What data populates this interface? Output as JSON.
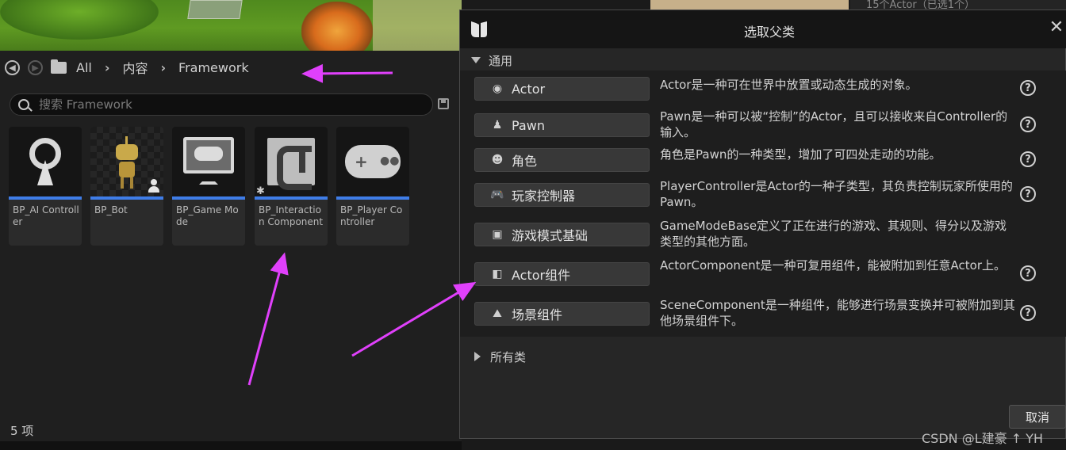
{
  "viewport": {
    "outliner_title": "15个Actor（已选1个）"
  },
  "content_browser": {
    "breadcrumb": [
      "All",
      "内容",
      "Framework"
    ],
    "search_placeholder": "搜索 Framework",
    "assets": [
      {
        "label": "BP_AI Controller"
      },
      {
        "label": "BP_Bot"
      },
      {
        "label": "BP_Game Mode"
      },
      {
        "label": "BP_Interaction Component"
      },
      {
        "label": "BP_Player Controller"
      }
    ],
    "item_count": "5 项"
  },
  "dialog": {
    "title": "选取父类",
    "section_common": "通用",
    "section_all": "所有类",
    "classes": [
      {
        "name": "Actor",
        "icon": "actor-icon",
        "description": "Actor是一种可在世界中放置或动态生成的对象。",
        "help": true
      },
      {
        "name": "Pawn",
        "icon": "pawn-icon",
        "description": "Pawn是一种可以被“控制”的Actor，且可以接收来自Controller的输入。",
        "help": true
      },
      {
        "name": "角色",
        "icon": "character-icon",
        "description": "角色是Pawn的一种类型，增加了可四处走动的功能。",
        "help": true
      },
      {
        "name": "玩家控制器",
        "icon": "gamepad-icon",
        "description": "PlayerController是Actor的一种子类型，其负责控制玩家所使用的Pawn。",
        "help": true
      },
      {
        "name": "游戏模式基础",
        "icon": "game-mode-icon",
        "description": "GameModeBase定义了正在进行的游戏、其规则、得分以及游戏类型的其他方面。",
        "help": false
      },
      {
        "name": "Actor组件",
        "icon": "actor-component-icon",
        "description": "ActorComponent是一种可复用组件，能被附加到任意Actor上。",
        "help": true
      },
      {
        "name": "场景组件",
        "icon": "scene-component-icon",
        "description": "SceneComponent是一种组件，能够进行场景变换并可被附加到其他场景组件下。",
        "help": true
      }
    ],
    "cancel_label": "取消"
  },
  "watermark": "CSDN @L建豪 ↑ YH",
  "colors": {
    "accent_bar": "#3f7de8",
    "annotation_arrow": "#e040fb"
  }
}
